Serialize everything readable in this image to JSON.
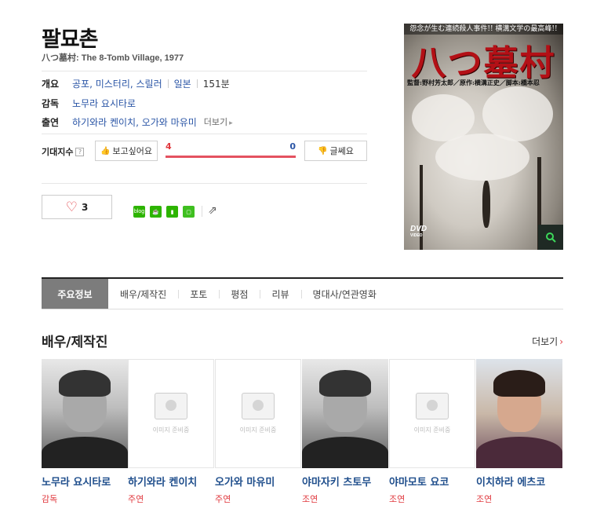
{
  "movie": {
    "title": "팔묘촌",
    "subtitle": "八つ墓村: The 8-Tomb Village, 1977"
  },
  "info": {
    "overview_label": "개요",
    "genres": "공포, 미스터리, 스릴러",
    "country": "일본",
    "runtime": "151분",
    "director_label": "감독",
    "director": "노무라 요시타로",
    "cast_label": "출연",
    "cast": "하기와라 켄이치, 오가와 마유미",
    "more_label": "더보기"
  },
  "expectation": {
    "label": "기대지수",
    "help": "?",
    "want_label": "보고싶어요",
    "dont_label": "글쎄요",
    "want_count": "4",
    "dont_count": "0",
    "want_fraction": 1.0
  },
  "like": {
    "count": "3"
  },
  "share": {
    "icons": [
      "blog-icon",
      "cafe-icon",
      "bookmark-icon",
      "note-icon"
    ],
    "blog_text": "blog",
    "colors": [
      "#2db400",
      "#2db400",
      "#2db400",
      "#2db400"
    ]
  },
  "poster": {
    "top_text": "怨念が生む連続殺人事件!! 横溝文学の最高峰!!",
    "title": "八つ墓村",
    "credit": "監督:野村芳太郎／原作:横溝正史／脚本:橋本忍",
    "dvd": "DVD",
    "dvd_sub": "VIDEO"
  },
  "tabs": [
    "주요정보",
    "배우/제작진",
    "포토",
    "평점",
    "리뷰",
    "명대사/연관영화"
  ],
  "cast_section": {
    "title": "배우/제작진",
    "more": "더보기",
    "placeholder_text": "이미지 준비중",
    "members": [
      {
        "name": "노무라 요시타로",
        "role": "감독",
        "photo": "real"
      },
      {
        "name": "하기와라 켄이치",
        "role": "주연",
        "photo": "placeholder"
      },
      {
        "name": "오가와 마유미",
        "role": "주연",
        "photo": "placeholder"
      },
      {
        "name": "야마자키 츠토무",
        "role": "조연",
        "photo": "real"
      },
      {
        "name": "야마모토 요코",
        "role": "조연",
        "photo": "placeholder"
      },
      {
        "name": "이치하라 에츠코",
        "role": "조연",
        "photo": "real-color"
      }
    ]
  },
  "colors": {
    "accent": "#e0383e",
    "link": "#2a55a6",
    "bar": "#e45260"
  }
}
